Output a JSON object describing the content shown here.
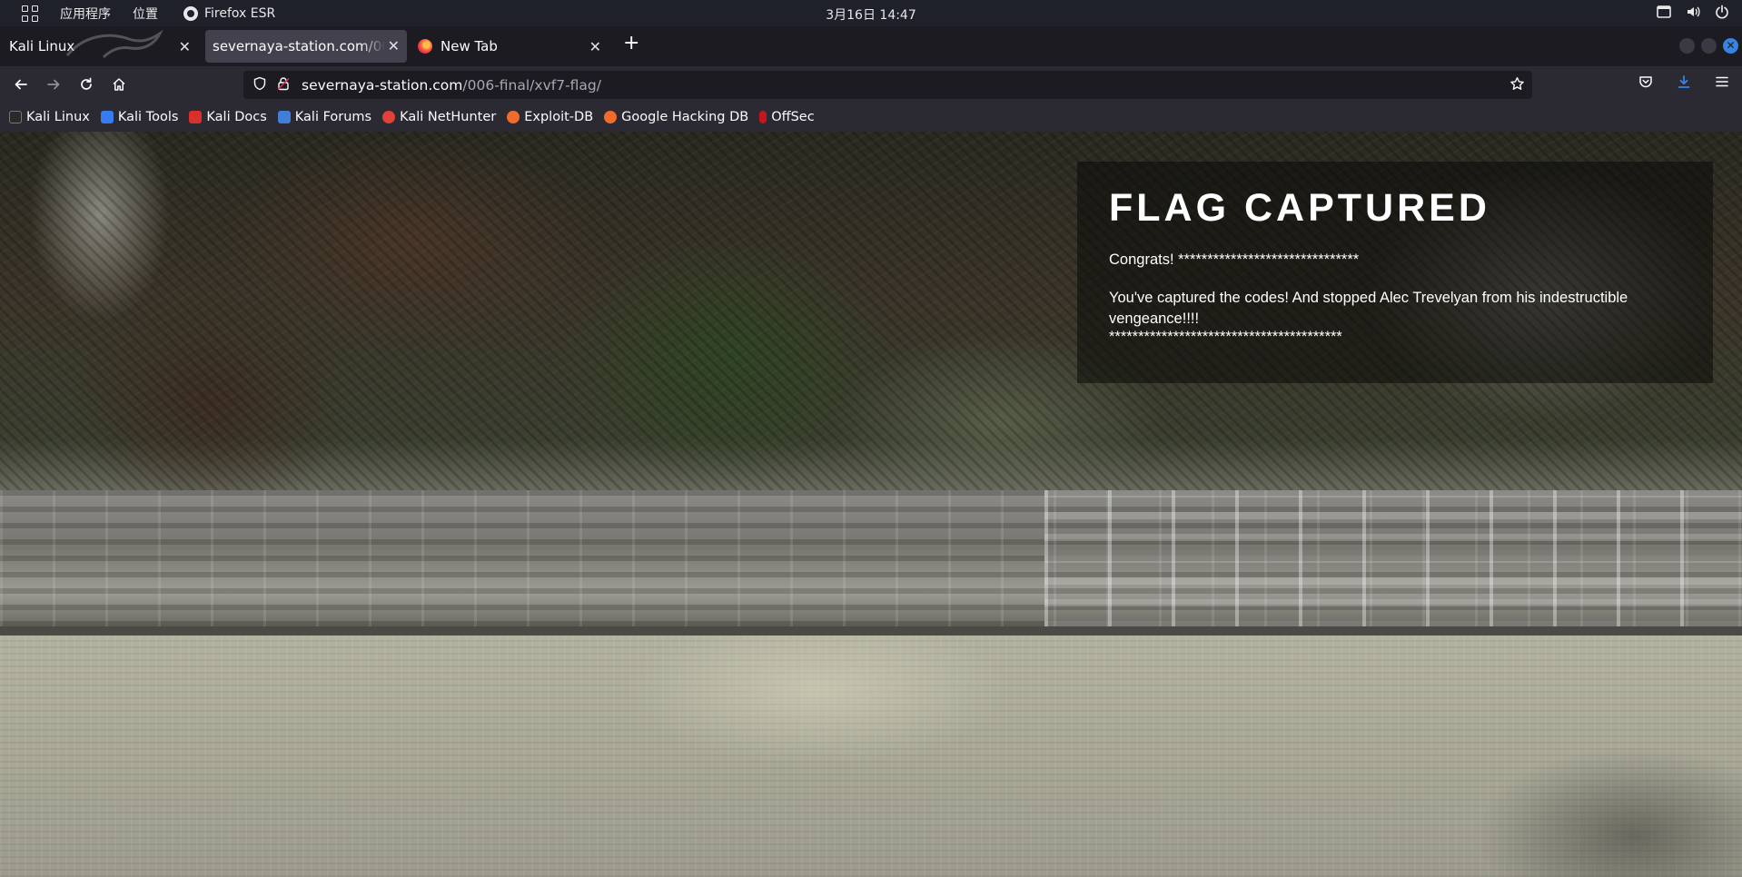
{
  "system_bar": {
    "applications": "应用程序",
    "places": "位置",
    "active_app": "Firefox ESR",
    "clock": "3月16日  14:47"
  },
  "tabs": [
    {
      "title": "Kali Linux"
    },
    {
      "title": "severnaya-station.com/006-final/xvf7-flag/",
      "active": true
    },
    {
      "title": "New Tab"
    }
  ],
  "url": {
    "host": "severnaya-station.com",
    "path": "/006-final/xvf7-flag/"
  },
  "bookmarks": [
    {
      "label": "Kali Linux",
      "icon": "kali-dragon-icon",
      "color": "#1d1d1d"
    },
    {
      "label": "Kali Tools",
      "icon": "kali-tools-icon",
      "color": "#367bf0"
    },
    {
      "label": "Kali Docs",
      "icon": "kali-docs-icon",
      "color": "#d9302c"
    },
    {
      "label": "Kali Forums",
      "icon": "kali-forums-icon",
      "color": "#3f7fd8"
    },
    {
      "label": "Kali NetHunter",
      "icon": "nethunter-icon",
      "color": "#e2403a"
    },
    {
      "label": "Exploit-DB",
      "icon": "exploit-db-icon",
      "color": "#ef6c2c"
    },
    {
      "label": "Google Hacking DB",
      "icon": "ghdb-icon",
      "color": "#ef6c2c"
    },
    {
      "label": "OffSec",
      "icon": "offsec-icon",
      "color": "#c4161c"
    }
  ],
  "page": {
    "title": "FLAG CAPTURED",
    "congrats": "Congrats! *******************************",
    "message": "You've captured the codes! And stopped Alec Trevelyan from his indestructible vengeance!!!!",
    "stars": "****************************************"
  },
  "colors": {
    "accent": "#3584e4",
    "download_active": "#3584e4"
  }
}
